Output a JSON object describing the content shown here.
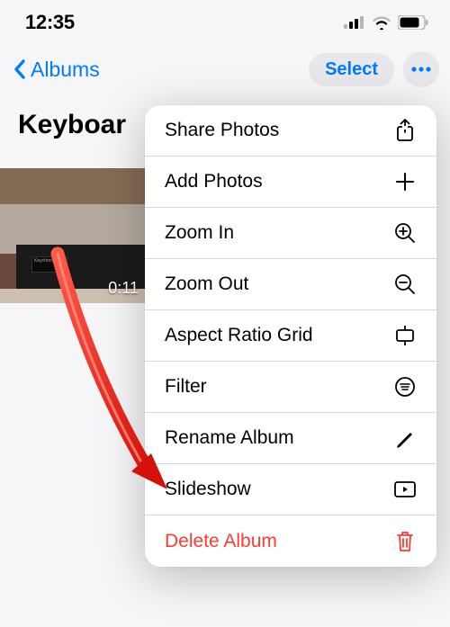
{
  "status": {
    "time": "12:35"
  },
  "nav": {
    "back_label": "Albums",
    "select_label": "Select"
  },
  "album": {
    "title": "Keyboar",
    "thumbnail_duration": "0:11"
  },
  "menu": {
    "items": [
      {
        "label": "Share Photos",
        "icon": "share-icon",
        "destructive": false
      },
      {
        "label": "Add Photos",
        "icon": "plus-icon",
        "destructive": false
      },
      {
        "label": "Zoom In",
        "icon": "zoom-in-icon",
        "destructive": false
      },
      {
        "label": "Zoom Out",
        "icon": "zoom-out-icon",
        "destructive": false
      },
      {
        "label": "Aspect Ratio Grid",
        "icon": "aspect-ratio-icon",
        "destructive": false
      },
      {
        "label": "Filter",
        "icon": "filter-icon",
        "destructive": false
      },
      {
        "label": "Rename Album",
        "icon": "pencil-icon",
        "destructive": false
      },
      {
        "label": "Slideshow",
        "icon": "slideshow-icon",
        "destructive": false
      },
      {
        "label": "Delete Album",
        "icon": "trash-icon",
        "destructive": true
      }
    ]
  }
}
